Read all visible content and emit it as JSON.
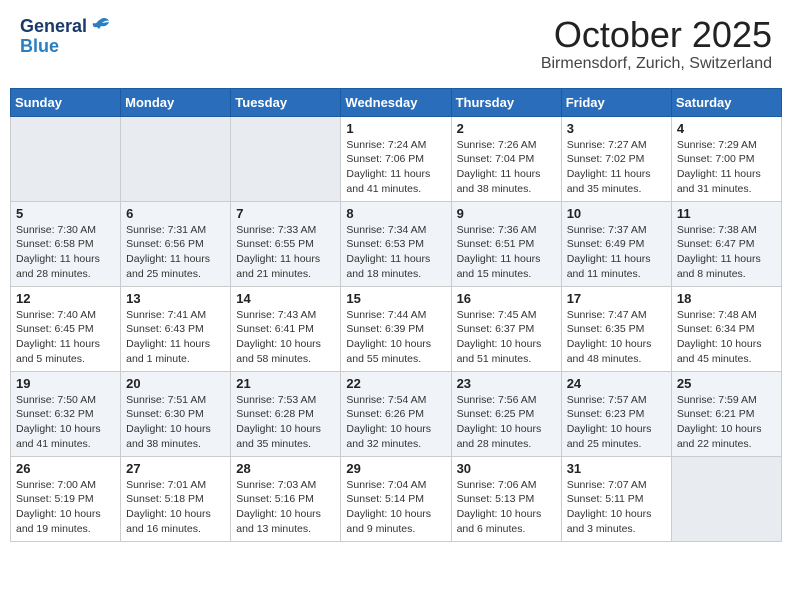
{
  "header": {
    "logo": {
      "general": "General",
      "blue": "Blue"
    },
    "title": "October 2025",
    "location": "Birmensdorf, Zurich, Switzerland"
  },
  "weekdays": [
    "Sunday",
    "Monday",
    "Tuesday",
    "Wednesday",
    "Thursday",
    "Friday",
    "Saturday"
  ],
  "weeks": [
    [
      {
        "day": "",
        "info": ""
      },
      {
        "day": "",
        "info": ""
      },
      {
        "day": "",
        "info": ""
      },
      {
        "day": "1",
        "info": "Sunrise: 7:24 AM\nSunset: 7:06 PM\nDaylight: 11 hours\nand 41 minutes."
      },
      {
        "day": "2",
        "info": "Sunrise: 7:26 AM\nSunset: 7:04 PM\nDaylight: 11 hours\nand 38 minutes."
      },
      {
        "day": "3",
        "info": "Sunrise: 7:27 AM\nSunset: 7:02 PM\nDaylight: 11 hours\nand 35 minutes."
      },
      {
        "day": "4",
        "info": "Sunrise: 7:29 AM\nSunset: 7:00 PM\nDaylight: 11 hours\nand 31 minutes."
      }
    ],
    [
      {
        "day": "5",
        "info": "Sunrise: 7:30 AM\nSunset: 6:58 PM\nDaylight: 11 hours\nand 28 minutes."
      },
      {
        "day": "6",
        "info": "Sunrise: 7:31 AM\nSunset: 6:56 PM\nDaylight: 11 hours\nand 25 minutes."
      },
      {
        "day": "7",
        "info": "Sunrise: 7:33 AM\nSunset: 6:55 PM\nDaylight: 11 hours\nand 21 minutes."
      },
      {
        "day": "8",
        "info": "Sunrise: 7:34 AM\nSunset: 6:53 PM\nDaylight: 11 hours\nand 18 minutes."
      },
      {
        "day": "9",
        "info": "Sunrise: 7:36 AM\nSunset: 6:51 PM\nDaylight: 11 hours\nand 15 minutes."
      },
      {
        "day": "10",
        "info": "Sunrise: 7:37 AM\nSunset: 6:49 PM\nDaylight: 11 hours\nand 11 minutes."
      },
      {
        "day": "11",
        "info": "Sunrise: 7:38 AM\nSunset: 6:47 PM\nDaylight: 11 hours\nand 8 minutes."
      }
    ],
    [
      {
        "day": "12",
        "info": "Sunrise: 7:40 AM\nSunset: 6:45 PM\nDaylight: 11 hours\nand 5 minutes."
      },
      {
        "day": "13",
        "info": "Sunrise: 7:41 AM\nSunset: 6:43 PM\nDaylight: 11 hours\nand 1 minute."
      },
      {
        "day": "14",
        "info": "Sunrise: 7:43 AM\nSunset: 6:41 PM\nDaylight: 10 hours\nand 58 minutes."
      },
      {
        "day": "15",
        "info": "Sunrise: 7:44 AM\nSunset: 6:39 PM\nDaylight: 10 hours\nand 55 minutes."
      },
      {
        "day": "16",
        "info": "Sunrise: 7:45 AM\nSunset: 6:37 PM\nDaylight: 10 hours\nand 51 minutes."
      },
      {
        "day": "17",
        "info": "Sunrise: 7:47 AM\nSunset: 6:35 PM\nDaylight: 10 hours\nand 48 minutes."
      },
      {
        "day": "18",
        "info": "Sunrise: 7:48 AM\nSunset: 6:34 PM\nDaylight: 10 hours\nand 45 minutes."
      }
    ],
    [
      {
        "day": "19",
        "info": "Sunrise: 7:50 AM\nSunset: 6:32 PM\nDaylight: 10 hours\nand 41 minutes."
      },
      {
        "day": "20",
        "info": "Sunrise: 7:51 AM\nSunset: 6:30 PM\nDaylight: 10 hours\nand 38 minutes."
      },
      {
        "day": "21",
        "info": "Sunrise: 7:53 AM\nSunset: 6:28 PM\nDaylight: 10 hours\nand 35 minutes."
      },
      {
        "day": "22",
        "info": "Sunrise: 7:54 AM\nSunset: 6:26 PM\nDaylight: 10 hours\nand 32 minutes."
      },
      {
        "day": "23",
        "info": "Sunrise: 7:56 AM\nSunset: 6:25 PM\nDaylight: 10 hours\nand 28 minutes."
      },
      {
        "day": "24",
        "info": "Sunrise: 7:57 AM\nSunset: 6:23 PM\nDaylight: 10 hours\nand 25 minutes."
      },
      {
        "day": "25",
        "info": "Sunrise: 7:59 AM\nSunset: 6:21 PM\nDaylight: 10 hours\nand 22 minutes."
      }
    ],
    [
      {
        "day": "26",
        "info": "Sunrise: 7:00 AM\nSunset: 5:19 PM\nDaylight: 10 hours\nand 19 minutes."
      },
      {
        "day": "27",
        "info": "Sunrise: 7:01 AM\nSunset: 5:18 PM\nDaylight: 10 hours\nand 16 minutes."
      },
      {
        "day": "28",
        "info": "Sunrise: 7:03 AM\nSunset: 5:16 PM\nDaylight: 10 hours\nand 13 minutes."
      },
      {
        "day": "29",
        "info": "Sunrise: 7:04 AM\nSunset: 5:14 PM\nDaylight: 10 hours\nand 9 minutes."
      },
      {
        "day": "30",
        "info": "Sunrise: 7:06 AM\nSunset: 5:13 PM\nDaylight: 10 hours\nand 6 minutes."
      },
      {
        "day": "31",
        "info": "Sunrise: 7:07 AM\nSunset: 5:11 PM\nDaylight: 10 hours\nand 3 minutes."
      },
      {
        "day": "",
        "info": ""
      }
    ]
  ]
}
